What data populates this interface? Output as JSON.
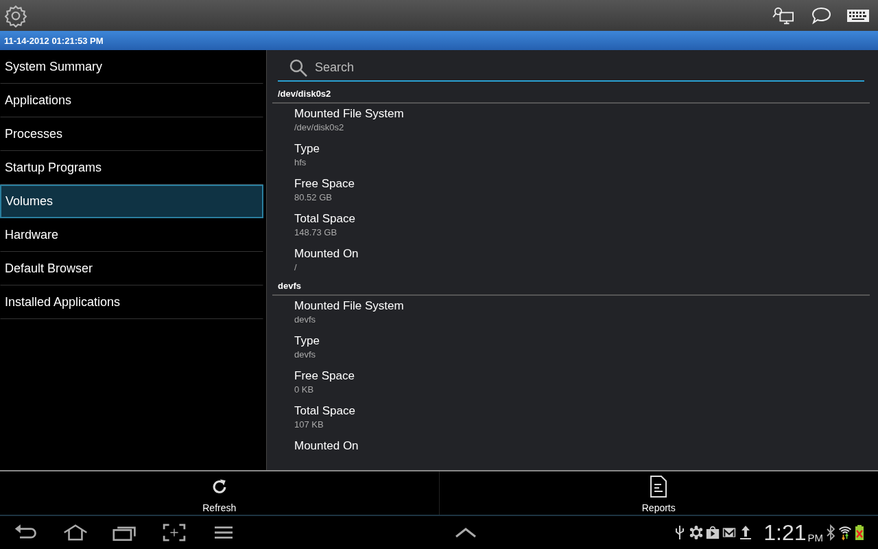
{
  "timestamp": "11-14-2012 01:21:53 PM",
  "sidebar": {
    "items": [
      {
        "label": "System Summary",
        "selected": false
      },
      {
        "label": "Applications",
        "selected": false
      },
      {
        "label": "Processes",
        "selected": false
      },
      {
        "label": "Startup Programs",
        "selected": false
      },
      {
        "label": "Volumes",
        "selected": true
      },
      {
        "label": "Hardware",
        "selected": false
      },
      {
        "label": "Default Browser",
        "selected": false
      },
      {
        "label": "Installed Applications",
        "selected": false
      }
    ]
  },
  "search": {
    "placeholder": "Search"
  },
  "volumes": [
    {
      "name": "/dev/disk0s2",
      "properties": [
        {
          "label": "Mounted File System",
          "value": "/dev/disk0s2"
        },
        {
          "label": "Type",
          "value": "hfs"
        },
        {
          "label": "Free Space",
          "value": "80.52 GB"
        },
        {
          "label": "Total Space",
          "value": "148.73 GB"
        },
        {
          "label": "Mounted On",
          "value": "/"
        }
      ]
    },
    {
      "name": "devfs",
      "properties": [
        {
          "label": "Mounted File System",
          "value": "devfs"
        },
        {
          "label": "Type",
          "value": "devfs"
        },
        {
          "label": "Free Space",
          "value": "0 KB"
        },
        {
          "label": "Total Space",
          "value": "107 KB"
        },
        {
          "label": "Mounted On"
        }
      ]
    }
  ],
  "action_bar": {
    "buttons": [
      {
        "label": "Refresh",
        "kind": "refresh"
      },
      {
        "label": "Reports",
        "kind": "reports"
      }
    ]
  },
  "status_bar": {
    "time": "1:21",
    "period": "PM"
  }
}
